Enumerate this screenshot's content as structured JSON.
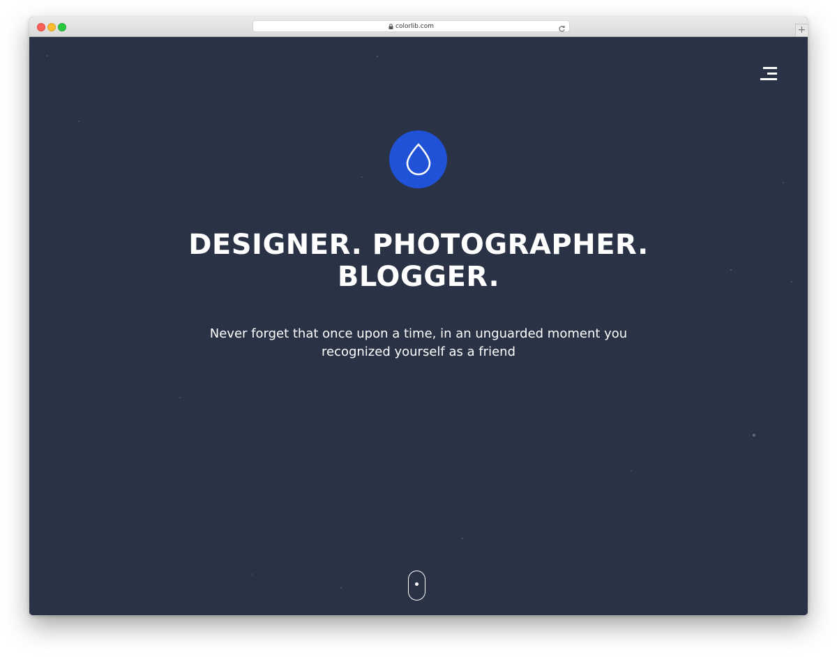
{
  "browser": {
    "url": "colorlib.com",
    "new_tab_symbol": "+"
  },
  "hero": {
    "headline_line1": "DESIGNER. PHOTOGRAPHER.",
    "headline_line2": "BLOGGER.",
    "tagline_line1": "Never forget that once upon a time, in an unguarded moment you",
    "tagline_line2": "recognized yourself as a friend",
    "logo_icon": "water-drop-icon"
  },
  "colors": {
    "background": "#2a3245",
    "accent": "#1f52d6",
    "text": "#ffffff"
  }
}
